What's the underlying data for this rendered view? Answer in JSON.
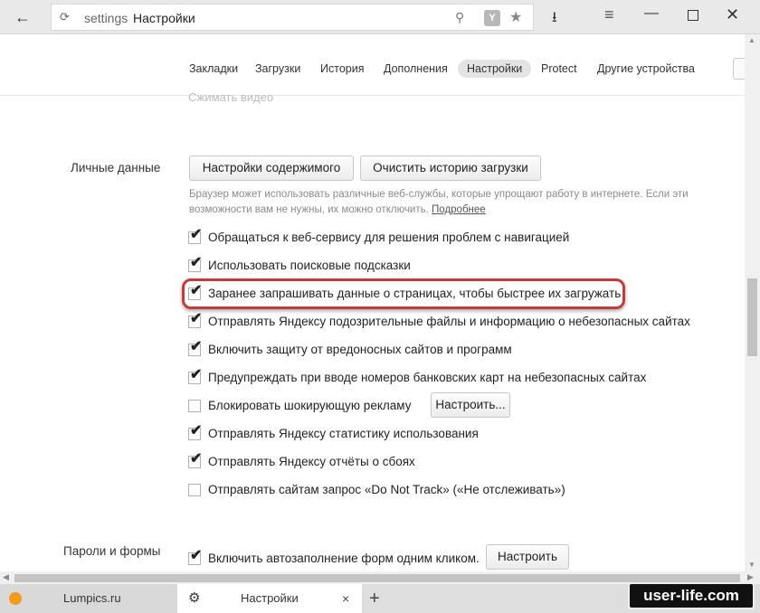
{
  "browser": {
    "url_prefix": "settings",
    "url_title": "Настройки",
    "icons": {
      "back": "back-arrow-icon",
      "reload": "reload-icon",
      "search": "search-icon",
      "yandex": "yandex-icon",
      "star": "star-icon",
      "download": "download-icon",
      "menu": "menu-icon",
      "minimize": "minimize-icon",
      "maximize": "maximize-icon",
      "close": "close-icon"
    },
    "yandex_letter": "Y"
  },
  "nav": {
    "items": [
      "Закладки",
      "Загрузки",
      "История",
      "Дополнения",
      "Настройки",
      "Protect",
      "Другие устройства"
    ],
    "active": "Настройки"
  },
  "ghost_text": "Сжимать видео",
  "personal": {
    "section_label": "Личные данные",
    "content_settings_button": "Настройки содержимого",
    "clear_history_button": "Очистить историю загрузки",
    "description": "Браузер может использовать различные веб-службы, которые упрощают работу в интернете. Если эти возможности вам не нужны, их можно отключить.",
    "more_link": "Подробнее",
    "options": [
      {
        "label": "Обращаться к веб-сервису для решения проблем с навигацией",
        "checked": true
      },
      {
        "label": "Использовать поисковые подсказки",
        "checked": true
      },
      {
        "label": "Заранее запрашивать данные о страницах, чтобы быстрее их загружать",
        "checked": true
      },
      {
        "label": "Отправлять Яндексу подозрительные файлы и информацию о небезопасных сайтах",
        "checked": true
      },
      {
        "label": "Включить защиту от вредоносных сайтов и программ",
        "checked": true
      },
      {
        "label": "Предупреждать при вводе номеров банковских карт на небезопасных сайтах",
        "checked": true
      },
      {
        "label": "Блокировать шокирующую рекламу",
        "checked": false
      },
      {
        "label": "Отправлять Яндексу статистику использования",
        "checked": true
      },
      {
        "label": "Отправлять Яндексу отчёты о сбоях",
        "checked": true
      },
      {
        "label": "Отправлять сайтам запрос «Do Not Track» («Не отслеживать»)",
        "checked": false
      }
    ],
    "ads_configure_button": "Настроить...",
    "highlighted_option": 2
  },
  "passwords": {
    "section_label": "Пароли и формы",
    "autofill_label": "Включить автозаполнение форм одним кликом.",
    "autofill_checked": true,
    "configure_button": "Настроить"
  },
  "tabs": [
    {
      "title": "Lumpics.ru",
      "icon": "orange-favicon-icon"
    },
    {
      "title": "Настройки",
      "icon": "gear-icon"
    }
  ],
  "tab_close": "×",
  "new_tab": "+",
  "watermark": "user-life.com",
  "colors": {
    "highlight": "#c73a3a",
    "checkbox_tick": "#222222"
  }
}
